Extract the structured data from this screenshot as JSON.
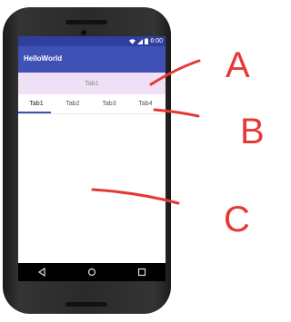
{
  "status": {
    "time": "6:00"
  },
  "app": {
    "title": "HelloWorld"
  },
  "banner": {
    "text": "Tab1"
  },
  "tabs": [
    {
      "label": "Tab1",
      "selected": true
    },
    {
      "label": "Tab2",
      "selected": false
    },
    {
      "label": "Tab3",
      "selected": false
    },
    {
      "label": "Tab4",
      "selected": false
    }
  ],
  "annotations": {
    "a": "A",
    "b": "B",
    "c": "C",
    "color": "#e53935"
  },
  "colors": {
    "status_bar": "#303f9f",
    "app_bar": "#3f51b5",
    "banner": "#efe0f5"
  },
  "icons": {
    "status": [
      "wifi-icon",
      "signal-icon",
      "battery-icon"
    ],
    "nav": [
      "back-icon",
      "home-icon",
      "recents-icon"
    ]
  }
}
